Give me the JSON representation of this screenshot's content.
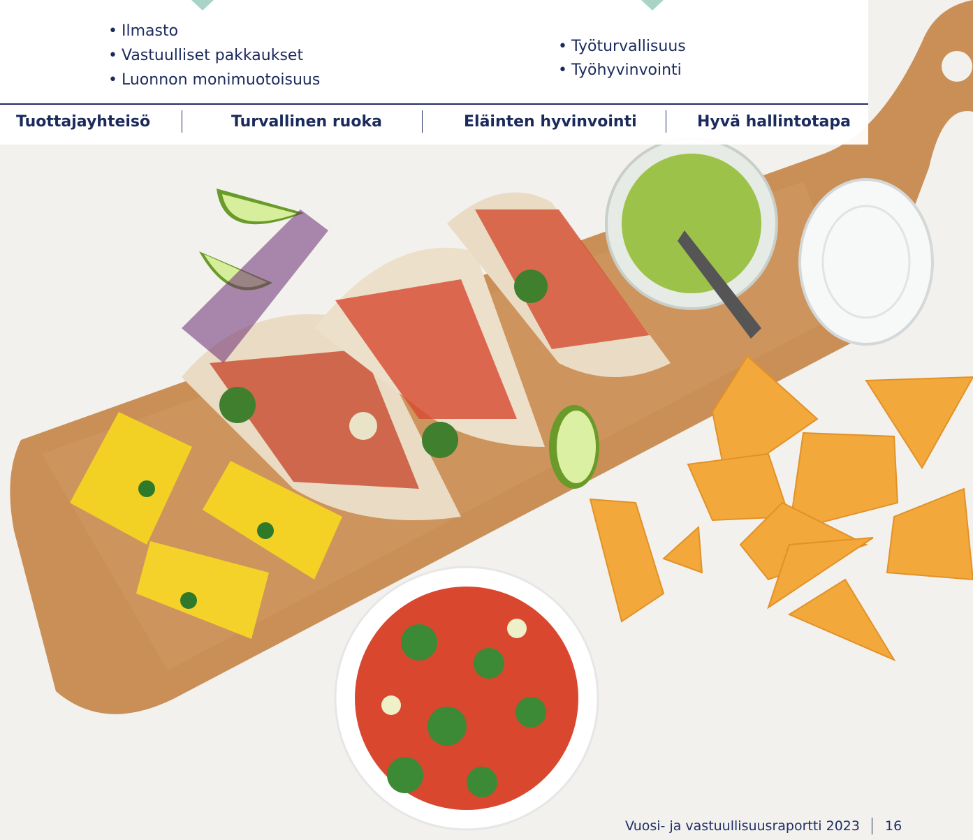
{
  "lists": {
    "left": [
      "Ilmasto",
      "Vastuulliset pakkaukset",
      "Luonnon monimuotoisuus"
    ],
    "right": [
      "Työturvallisuus",
      "Työhyvinvointi"
    ]
  },
  "bullet": "•",
  "categories": [
    "Tuottajayhteisö",
    "Turvallinen ruoka",
    "Eläinten hyvinvointi",
    "Hyvä hallintotapa"
  ],
  "footer": {
    "report_title": "Vuosi- ja vastuullisuusraportti 2023",
    "page_number": "16"
  },
  "colors": {
    "navy": "#1b2a5c",
    "accent": "#a9d3c7",
    "board": "#c98f56"
  }
}
